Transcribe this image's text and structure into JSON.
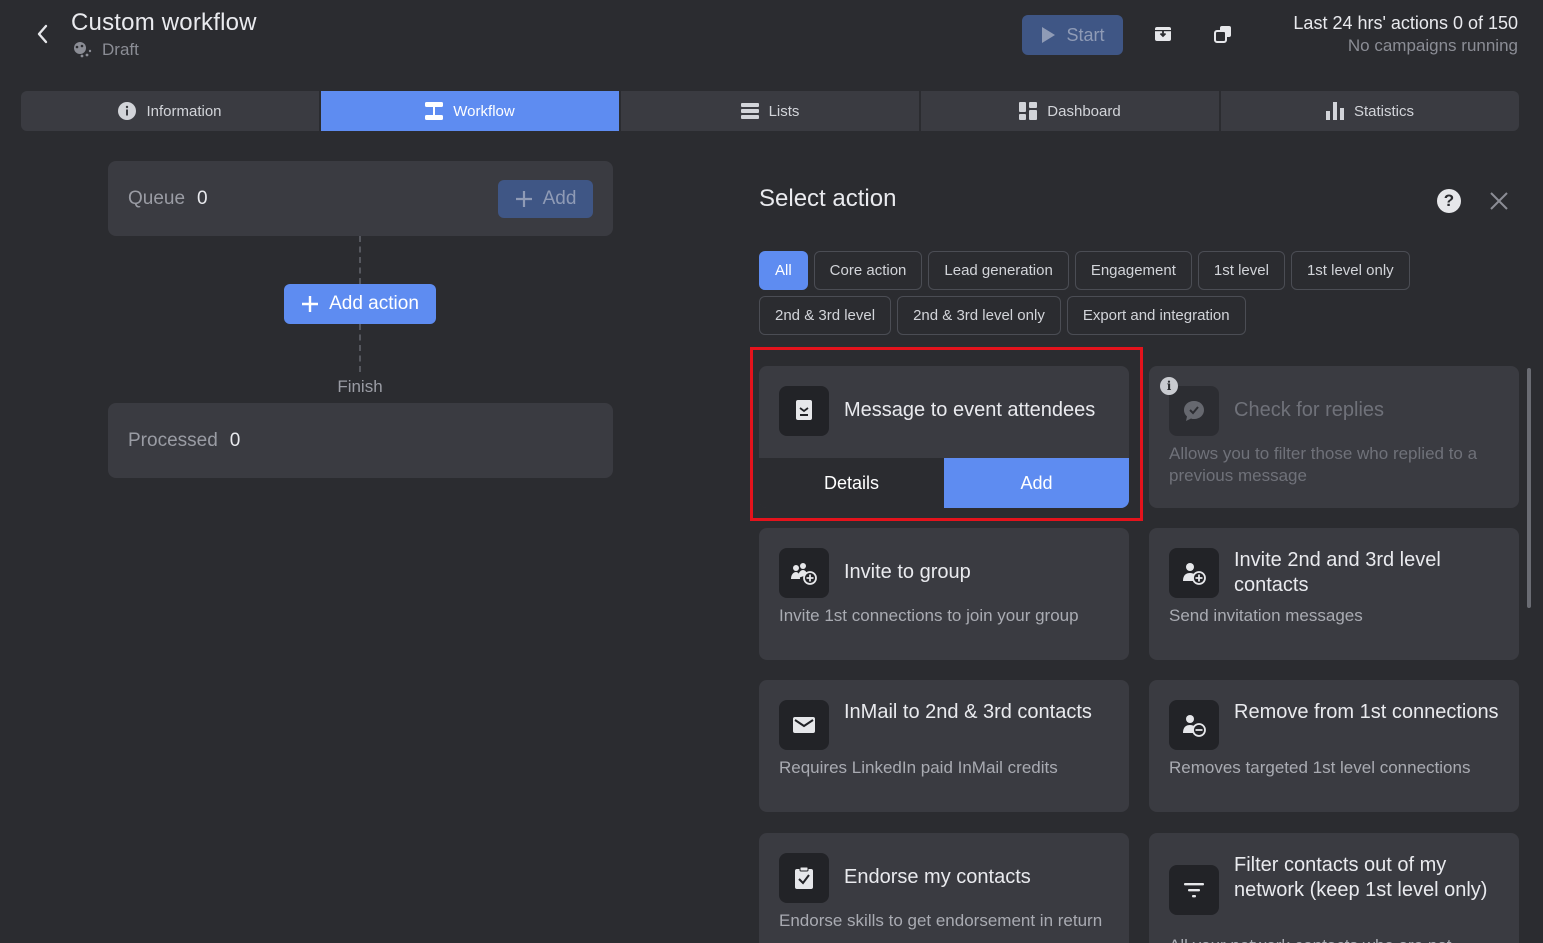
{
  "header": {
    "title": "Custom workflow",
    "status": "Draft",
    "start_label": "Start",
    "actions_text": "Last 24 hrs' actions 0 of 150",
    "campaigns_text": "No campaigns running"
  },
  "tabs": [
    {
      "label": "Information",
      "icon": "info-icon"
    },
    {
      "label": "Workflow",
      "icon": "workflow-icon",
      "active": true
    },
    {
      "label": "Lists",
      "icon": "list-icon"
    },
    {
      "label": "Dashboard",
      "icon": "dashboard-icon"
    },
    {
      "label": "Statistics",
      "icon": "bar-chart-icon"
    }
  ],
  "workflow": {
    "queue_label": "Queue",
    "queue_count": "0",
    "queue_add_label": "Add",
    "add_action_label": "Add action",
    "finish_label": "Finish",
    "processed_label": "Processed",
    "processed_count": "0"
  },
  "panel": {
    "title": "Select action",
    "filters": [
      "All",
      "Core action",
      "Lead generation",
      "Engagement",
      "1st level",
      "1st level only",
      "2nd & 3rd level",
      "2nd & 3rd level only",
      "Export and integration"
    ],
    "cards": [
      {
        "title": "Message to event attendees",
        "details_label": "Details",
        "add_label": "Add"
      },
      {
        "title": "Check for replies",
        "desc": "Allows you to filter those who replied to a previous message"
      },
      {
        "title": "Invite to group",
        "desc": "Invite 1st connections to join your group"
      },
      {
        "title": "Invite 2nd and 3rd level contacts",
        "desc": "Send invitation messages"
      },
      {
        "title": "InMail to 2nd & 3rd contacts",
        "desc": "Requires LinkedIn paid InMail credits"
      },
      {
        "title": "Remove from 1st connections",
        "desc": "Removes targeted 1st level connections"
      },
      {
        "title": "Endorse my contacts",
        "desc": "Endorse skills to get endorsement in return"
      },
      {
        "title": "Filter contacts out of my network (keep 1st level only)",
        "desc": "All your network contacts who are not"
      }
    ]
  },
  "colors": {
    "background": "#2b2c30",
    "surface": "#3a3b41",
    "accent": "#5e8cf1",
    "highlight": "#e4131c"
  }
}
